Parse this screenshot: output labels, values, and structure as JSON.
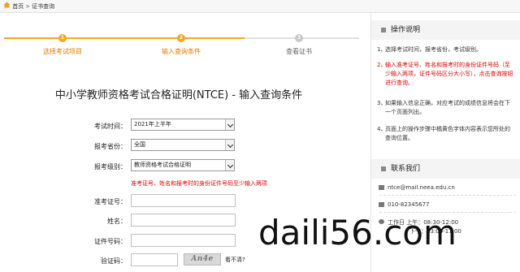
{
  "breadcrumb": {
    "home": "首页",
    "sep": ">",
    "current": "证书查询"
  },
  "steps": [
    {
      "num": "1",
      "label": "选择考试项目",
      "state": "done"
    },
    {
      "num": "2",
      "label": "输入查询条件",
      "state": "active"
    },
    {
      "num": "3",
      "label": "查看证书",
      "state": "todo"
    }
  ],
  "page_title": "中小学教师资格考试合格证明(NTCE) - 输入查询条件",
  "form": {
    "exam_time_label": "考试时间：",
    "exam_time_value": "2021年上半年",
    "province_label": "报考省份：",
    "province_value": "全国",
    "level_label": "报考级别：",
    "level_value": "教师资格考试合格证明",
    "warning": "准考证号、姓名和报考时的身份证件号码至少输入两项",
    "ticket_label": "准考证号：",
    "name_label": "姓名：",
    "id_label": "证件号码：",
    "captcha_label": "验证码：",
    "captcha_image_text": "An4e",
    "cant_see": "看不清?"
  },
  "sidebar": {
    "instructions_title": "操作说明",
    "instructions": [
      {
        "num": "1、",
        "text": "选择考试时间，报考省份，考试级别。",
        "red": false
      },
      {
        "num": "2、",
        "text": "输入准考证号、姓名和报考时的身份证件号码（至少输入两项，证件号码区分大小写），点击查询按钮进行查询。",
        "red": true
      },
      {
        "num": "3、",
        "text": "如果输入信息正确，对应考试的成绩信息将会在下一个页面列出。",
        "red": false
      },
      {
        "num": "4、",
        "text": "页面上的操作步骤中橘黄色字体内容表示您所处的查询位置。",
        "red": false
      }
    ],
    "contact_title": "联系我们",
    "email": "ntce@mail.neea.edu.cn",
    "phone": "010-82345677",
    "hours": "工作日 上午：08:30-12:00",
    "hours2": "下午：13:00-17:00"
  },
  "watermark": "daili56.com",
  "colors": {
    "accent": "#f5a623",
    "warning": "#e00000"
  }
}
